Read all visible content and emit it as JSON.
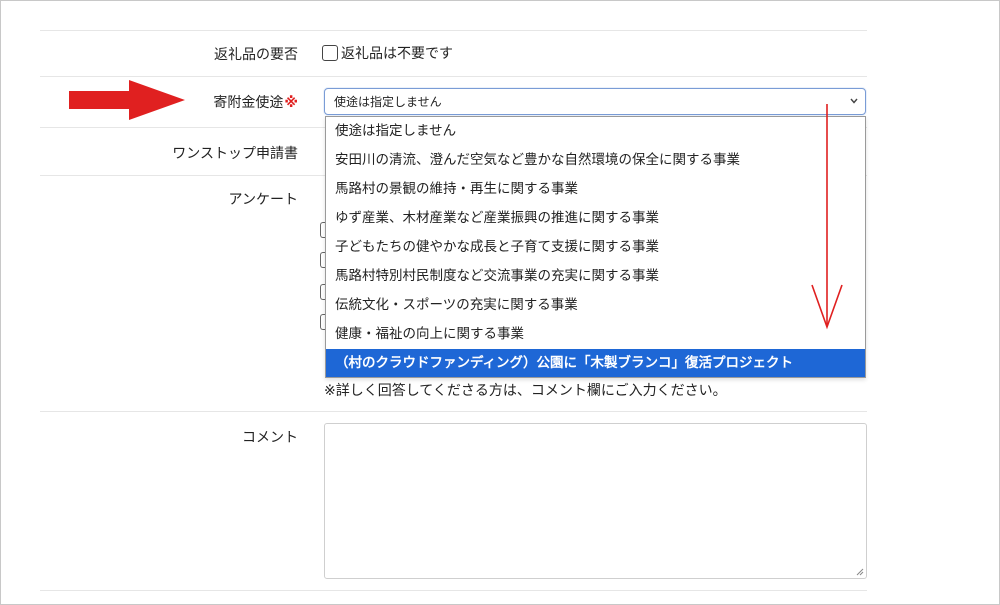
{
  "form": {
    "henreihin": {
      "label": "返礼品の要否",
      "checkbox_label": "返礼品は不要です"
    },
    "shito": {
      "label": "寄附金使途",
      "required_mark": "※",
      "selected_value": "使途は指定しません",
      "options": [
        "使途は指定しません",
        "安田川の清流、澄んだ空気など豊かな自然環境の保全に関する事業",
        "馬路村の景観の維持・再生に関する事業",
        "ゆず産業、木材産業など産業振興の推進に関する事業",
        "子どもたちの健やかな成長と子育て支援に関する事業",
        "馬路村特別村民制度など交流事業の充実に関する事業",
        "伝統文化・スポーツの充実に関する事業",
        "健康・福祉の向上に関する事業",
        "（村のクラウドファンディング）公園に「木製ブランコ」復活プロジェクト"
      ],
      "highlighted_option_index": 8
    },
    "onestop": {
      "label": "ワンストップ申請書"
    },
    "survey": {
      "label": "アンケート",
      "note": "※詳しく回答してくださる方は、コメント欄にご入力ください。"
    },
    "comment": {
      "label": "コメント",
      "value": ""
    }
  },
  "colors": {
    "required": "#e02020",
    "highlight": "#1e67d6",
    "annotation_arrow": "#e02020"
  },
  "annotations": {
    "left_arrow": "thick-red-right-arrow",
    "down_arrow": "thin-red-down-arrow"
  }
}
